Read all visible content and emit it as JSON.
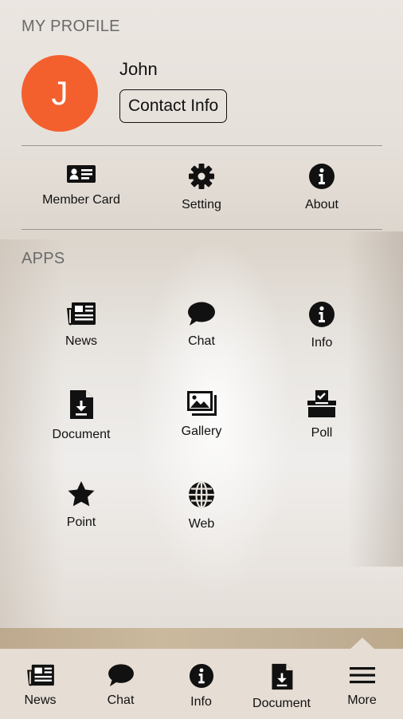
{
  "profile": {
    "section_title": "MY PROFILE",
    "avatar_initial": "J",
    "avatar_color": "#f3602e",
    "name": "John",
    "contact_button": "Contact Info"
  },
  "quick_actions": [
    {
      "label": "Member Card",
      "icon": "member-card-icon"
    },
    {
      "label": "Setting",
      "icon": "gear-icon"
    },
    {
      "label": "About",
      "icon": "info-icon"
    }
  ],
  "apps": {
    "section_title": "APPS",
    "items": [
      {
        "label": "News",
        "icon": "newspaper-icon"
      },
      {
        "label": "Chat",
        "icon": "chat-bubble-icon"
      },
      {
        "label": "Info",
        "icon": "info-icon"
      },
      {
        "label": "Document",
        "icon": "document-download-icon"
      },
      {
        "label": "Gallery",
        "icon": "gallery-icon"
      },
      {
        "label": "Poll",
        "icon": "ballot-box-icon"
      },
      {
        "label": "Point",
        "icon": "star-icon"
      },
      {
        "label": "Web",
        "icon": "globe-icon"
      }
    ]
  },
  "tabbar": {
    "items": [
      {
        "label": "News",
        "icon": "newspaper-icon"
      },
      {
        "label": "Chat",
        "icon": "chat-bubble-icon"
      },
      {
        "label": "Info",
        "icon": "info-icon"
      },
      {
        "label": "Document",
        "icon": "document-download-icon"
      },
      {
        "label": "More",
        "icon": "menu-icon"
      }
    ],
    "active_tab": "More"
  }
}
